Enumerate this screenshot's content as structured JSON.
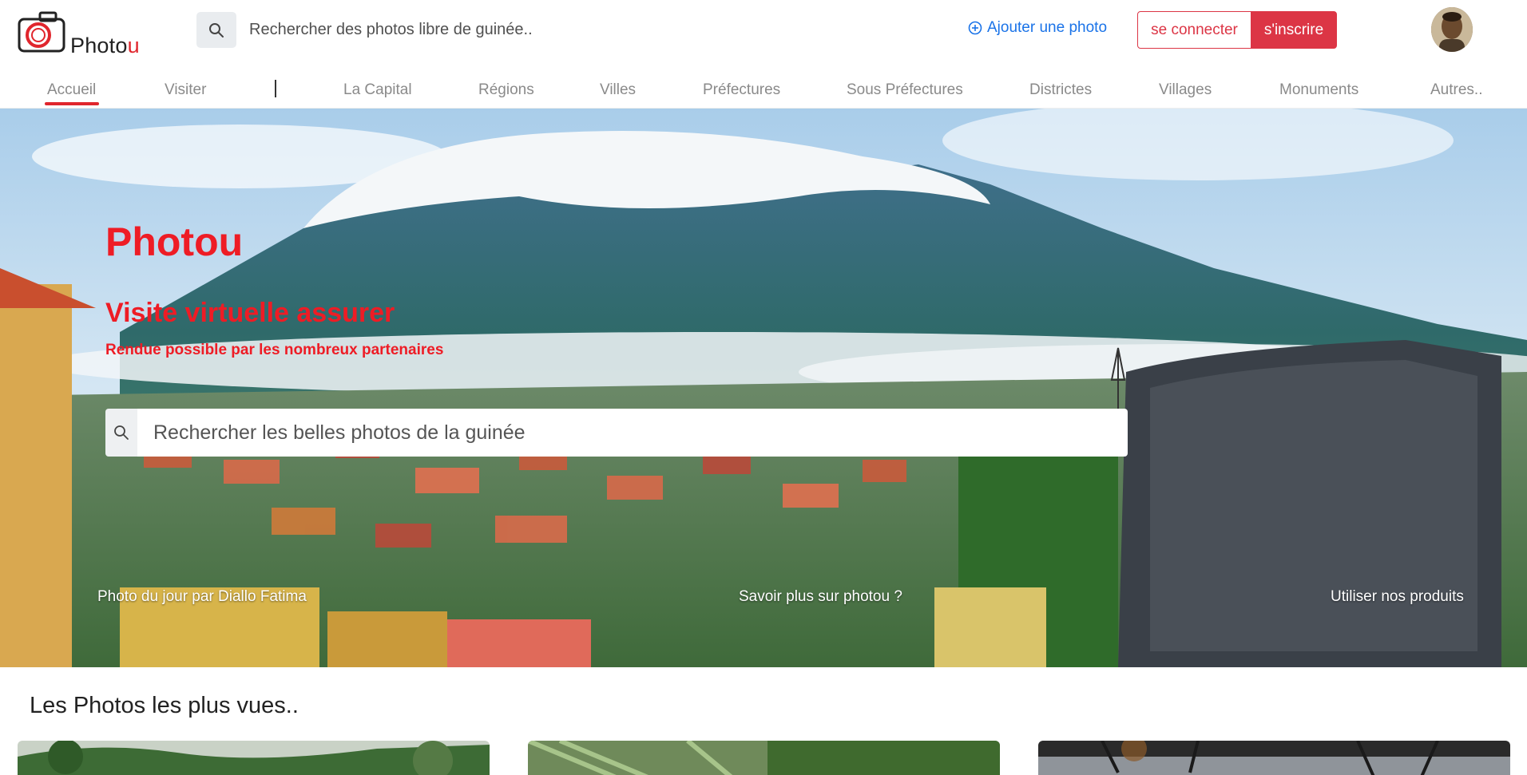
{
  "brand": {
    "name_main": "Photo",
    "name_accent": "u",
    "accent_color": "#e0262d"
  },
  "header": {
    "search_placeholder": "Rechercher des photos libre de guinée..",
    "add_photo_label": "Ajouter une photo",
    "login_label": "se connecter",
    "signup_label": "s'inscrire"
  },
  "nav": {
    "items": [
      {
        "label": "Accueil",
        "active": true
      },
      {
        "label": "Visiter"
      },
      {
        "label": "|"
      },
      {
        "label": "La Capital"
      },
      {
        "label": "Régions"
      },
      {
        "label": "Villes"
      },
      {
        "label": "Préfectures"
      },
      {
        "label": "Sous Préfectures"
      },
      {
        "label": "Districtes"
      },
      {
        "label": "Villages"
      },
      {
        "label": "Monuments"
      },
      {
        "label": "Autres.."
      }
    ]
  },
  "hero": {
    "title": "Photou",
    "subtitle": "Visite virtuelle assurer",
    "tagline": "Rendue possible par les nombreux partenaires",
    "search_placeholder": "Rechercher les belles photos de la guinée",
    "links": {
      "photo_of_day": "Photo du jour par Diallo Fatima",
      "learn_more": "Savoir plus sur photou ?",
      "products": "Utiliser nos produits"
    },
    "text_color": "#ee1c25"
  },
  "section": {
    "title": "Les Photos les plus vues.."
  }
}
